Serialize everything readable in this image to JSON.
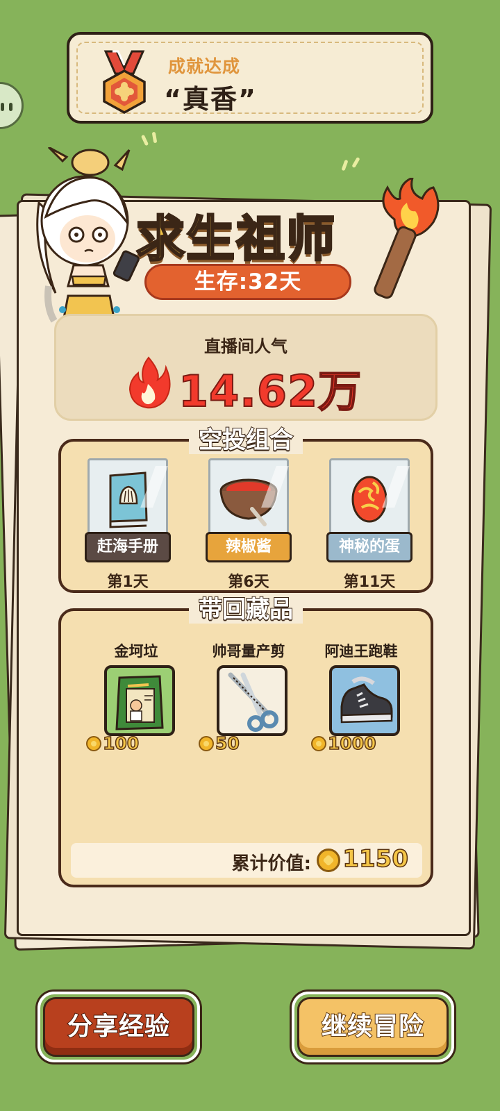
{
  "achievement": {
    "label": "成就达成",
    "value": "“真香”"
  },
  "title": "求生祖师",
  "survival": "生存:32天",
  "popularity": {
    "label": "直播间人气",
    "value": "14.62万"
  },
  "airdrop": {
    "title": "空投组合",
    "items": [
      {
        "name": "赶海手册",
        "day": "第1天",
        "icon": "book-icon"
      },
      {
        "name": "辣椒酱",
        "day": "第6天",
        "icon": "chili-sauce-icon"
      },
      {
        "name": "神秘的蛋",
        "day": "第11天",
        "icon": "mystery-egg-icon"
      }
    ]
  },
  "collection": {
    "title": "带回藏品",
    "items": [
      {
        "name": "金坷垃",
        "price": "100",
        "icon": "fertilizer-bag-icon"
      },
      {
        "name": "帅哥量产剪",
        "price": "50",
        "icon": "scissors-icon"
      },
      {
        "name": "阿迪王跑鞋",
        "price": "1000",
        "icon": "sneaker-icon"
      }
    ],
    "total_label": "累计价值:",
    "total_value": "1150"
  },
  "buttons": {
    "share": "分享经验",
    "continue": "继续冒险"
  },
  "colors": {
    "background": "#86b35a",
    "title_gold": "#f4c648",
    "popularity_red": "#f23a2c",
    "survival_orange": "#e3622f",
    "share_button": "#b8401e",
    "continue_button": "#f4c266"
  }
}
